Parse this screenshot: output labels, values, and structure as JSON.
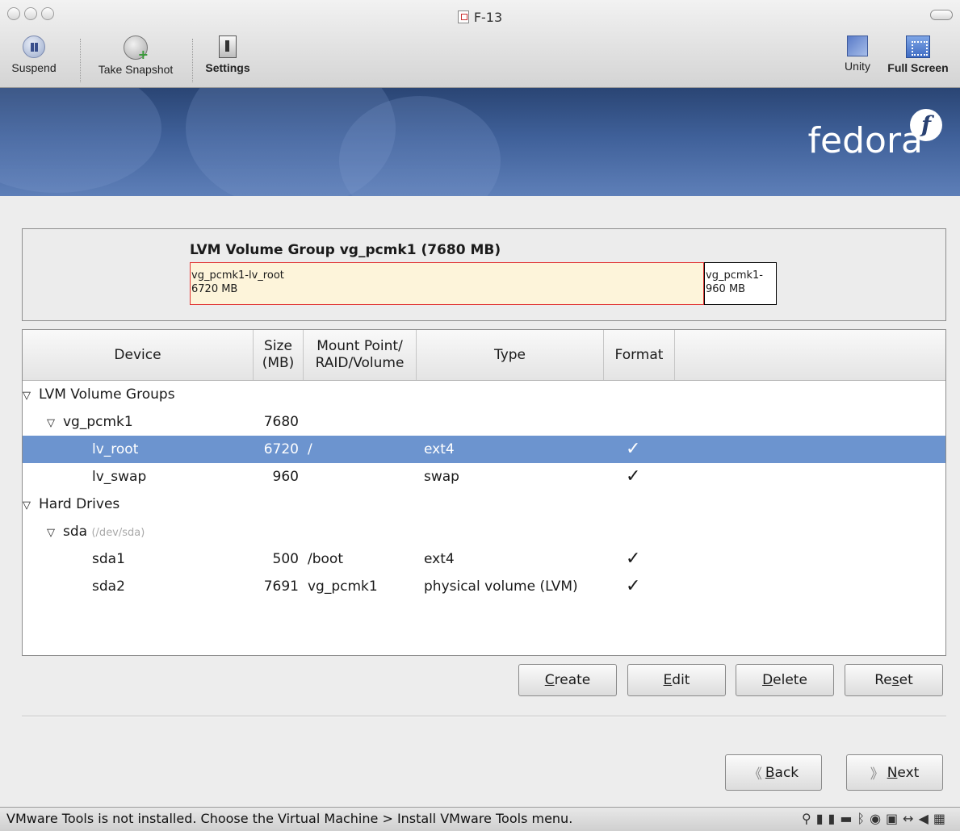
{
  "window": {
    "title": "F-13"
  },
  "toolbar": {
    "suspend": "Suspend",
    "snapshot": "Take Snapshot",
    "settings": "Settings",
    "unity": "Unity",
    "fullscreen": "Full Screen"
  },
  "banner": {
    "logo": "fedora"
  },
  "lvm": {
    "title": "LVM Volume Group vg_pcmk1 (7680 MB)",
    "segments": [
      {
        "name": "vg_pcmk1-lv_root",
        "size": "6720 MB"
      },
      {
        "name": "vg_pcmk1-",
        "size": "960 MB"
      }
    ]
  },
  "table": {
    "headers": {
      "device": "Device",
      "size_line1": "Size",
      "size_line2": "(MB)",
      "mount_line1": "Mount Point/",
      "mount_line2": "RAID/Volume",
      "type": "Type",
      "format": "Format"
    },
    "rows": [
      {
        "device": "LVM Volume Groups",
        "size": "",
        "mount": "",
        "type": "",
        "format": ""
      },
      {
        "device": "vg_pcmk1",
        "size": "7680",
        "mount": "",
        "type": "",
        "format": ""
      },
      {
        "device": "lv_root",
        "size": "6720",
        "mount": "/",
        "type": "ext4",
        "format": "✓"
      },
      {
        "device": "lv_swap",
        "size": "960",
        "mount": "",
        "type": "swap",
        "format": "✓"
      },
      {
        "device": "Hard Drives",
        "size": "",
        "mount": "",
        "type": "",
        "format": ""
      },
      {
        "device": "sda",
        "device_sub": "(/dev/sda)",
        "size": "",
        "mount": "",
        "type": "",
        "format": ""
      },
      {
        "device": "sda1",
        "size": "500",
        "mount": "/boot",
        "type": "ext4",
        "format": "✓"
      },
      {
        "device": "sda2",
        "size": "7691",
        "mount": "vg_pcmk1",
        "type": "physical volume (LVM)",
        "format": "✓"
      }
    ]
  },
  "actions": {
    "create_u": "C",
    "create_rest": "reate",
    "edit_u": "E",
    "edit_rest": "dit",
    "delete_u": "D",
    "delete_rest": "elete",
    "reset_a": "Re",
    "reset_u": "s",
    "reset_b": "et"
  },
  "nav": {
    "back_u": "B",
    "back_rest": "ack",
    "next_u": "N",
    "next_rest": "ext"
  },
  "status": {
    "message": "VMware Tools is not installed. Choose the Virtual Machine > Install VMware Tools menu."
  }
}
